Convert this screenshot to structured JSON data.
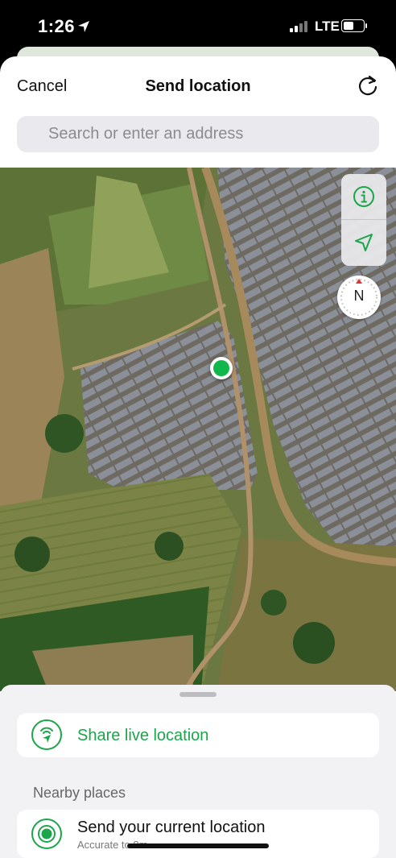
{
  "status_bar": {
    "time": "1:26",
    "network": "LTE"
  },
  "header": {
    "cancel_label": "Cancel",
    "title": "Send location",
    "refresh_icon": "refresh-icon"
  },
  "search": {
    "placeholder": "Search or enter an address"
  },
  "map": {
    "info_icon": "info-icon",
    "locate_icon": "location-arrow-icon",
    "compass_label": "N"
  },
  "panel": {
    "share_live_label": "Share live location",
    "nearby_title": "Nearby places",
    "current_location": {
      "label": "Send your current location",
      "accuracy": "Accurate to 8m"
    }
  },
  "colors": {
    "accent": "#1aa64a",
    "pin": "#10b84c"
  }
}
